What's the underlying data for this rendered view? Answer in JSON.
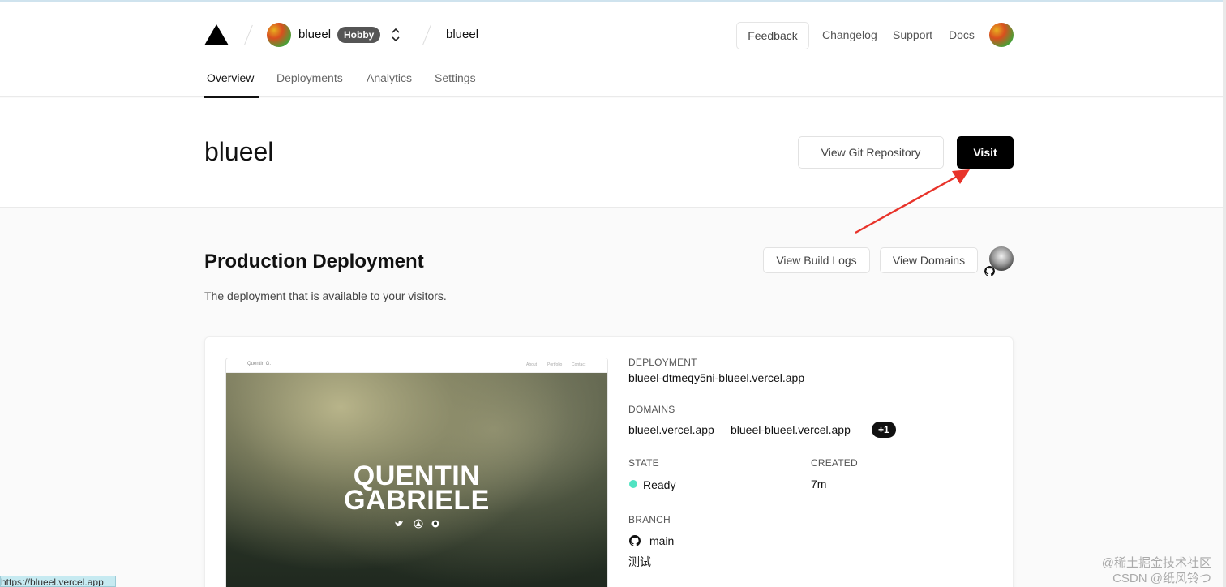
{
  "header": {
    "team": {
      "name": "blueel",
      "plan": "Hobby"
    },
    "project": "blueel",
    "nav": {
      "feedback": "Feedback",
      "changelog": "Changelog",
      "support": "Support",
      "docs": "Docs"
    },
    "tabs": [
      "Overview",
      "Deployments",
      "Analytics",
      "Settings"
    ]
  },
  "hero": {
    "title": "blueel",
    "git_button": "View Git Repository",
    "visit_button": "Visit"
  },
  "production": {
    "title": "Production Deployment",
    "description": "The deployment that is available to your visitors.",
    "build_logs_button": "View Build Logs",
    "domains_button": "View Domains",
    "preview": {
      "brand": "Quentin G.",
      "nav": [
        "About",
        "Portfolio",
        "Contact"
      ],
      "headline_1": "QUENTIN",
      "headline_2": "GABRIELE"
    },
    "deployment_label": "DEPLOYMENT",
    "deployment_value": "blueel-dtmeqy5ni-blueel.vercel.app",
    "domains_label": "DOMAINS",
    "domains": [
      "blueel.vercel.app",
      "blueel-blueel.vercel.app"
    ],
    "domains_extra": "+1",
    "state_label": "STATE",
    "state_value": "Ready",
    "created_label": "CREATED",
    "created_value": "7m",
    "branch_label": "BRANCH",
    "branch_value": "main",
    "commit_message": "测试"
  },
  "status_url": "https://blueel.vercel.app",
  "watermark": {
    "line1": "@稀土掘金技术社区",
    "line2": "CSDN @纸风铃つ"
  },
  "colors": {
    "ready": "#50e3c2",
    "visit_bg": "#000000",
    "annotation_arrow": "#e8332a"
  }
}
